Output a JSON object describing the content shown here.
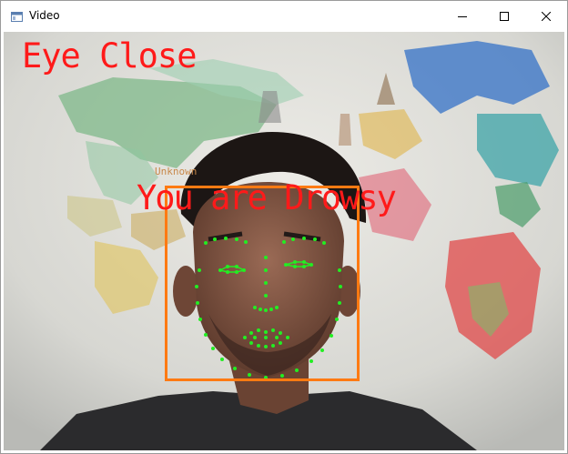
{
  "window": {
    "title": "Video",
    "app_icon": "window-app-icon",
    "controls": [
      "minimize-icon",
      "maximize-icon",
      "close-icon"
    ]
  },
  "overlay": {
    "status_eye": "Eye Close",
    "status_alert": "You are Drowsy",
    "face_label": "Unknown",
    "colors": {
      "alert_text": "#ff1a1a",
      "face_box": "#ff7a12",
      "face_label": "#c8884a",
      "landmarks": "#22ee22"
    }
  }
}
